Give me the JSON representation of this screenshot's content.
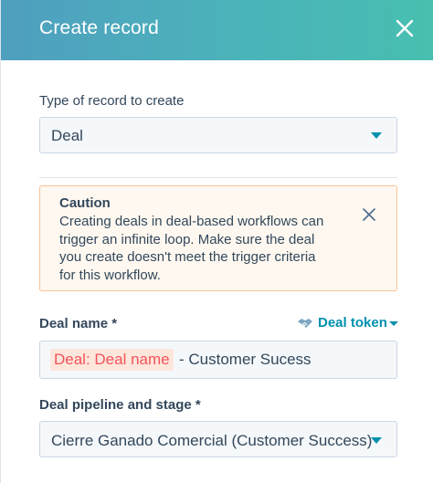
{
  "header": {
    "title": "Create record"
  },
  "record_type": {
    "label": "Type of record to create",
    "value": "Deal"
  },
  "caution": {
    "title": "Caution",
    "lines": [
      "Creating deals in deal-based workflows can",
      "trigger an infinite loop. Make sure the deal",
      "you create doesn't meet the trigger criteria",
      "for this workflow."
    ]
  },
  "deal_name": {
    "label": "Deal name *",
    "token_link": "Deal token",
    "token_value": "Deal: Deal name",
    "text_value": "- Customer Sucess"
  },
  "pipeline": {
    "label": "Deal pipeline and stage *",
    "value": "Cierre Ganado Comercial (Customer Success)"
  },
  "colors": {
    "header_gradient_start": "#4f9fbf",
    "header_gradient_end": "#48bfb0",
    "link": "#0091ae",
    "caution_bg": "#fef8f0",
    "caution_border": "#fbc295",
    "token_text": "#f2545b",
    "token_bg": "#fde6dc"
  },
  "icons": {
    "close": "close-icon",
    "alert_close": "close-icon",
    "token": "handshake-icon",
    "dropdown": "caret-down-icon"
  }
}
